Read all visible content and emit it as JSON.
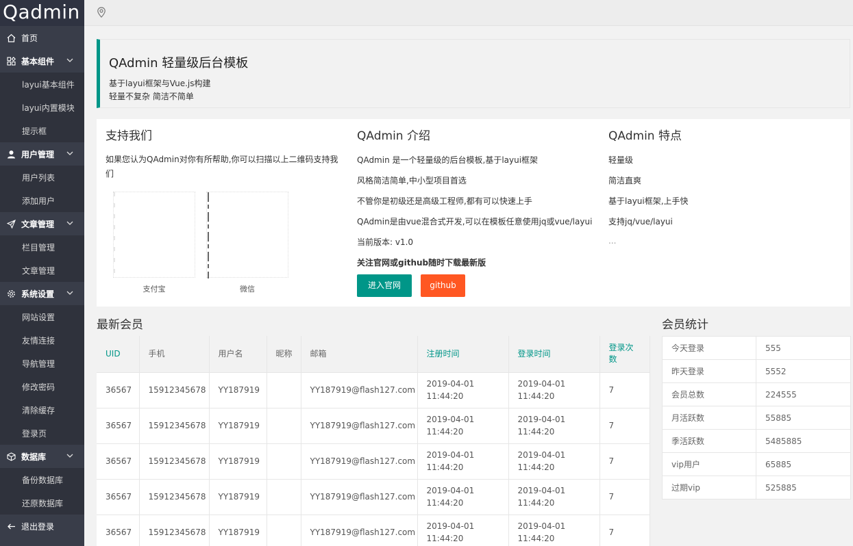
{
  "app": {
    "logo": "Qadmin"
  },
  "sidebar": {
    "items": [
      {
        "label": "首页",
        "type": "top",
        "icon": "home-icon"
      },
      {
        "label": "基本组件",
        "type": "parent",
        "icon": "components-icon"
      },
      {
        "label": "layui基本组件",
        "type": "sub"
      },
      {
        "label": "layui内置模块",
        "type": "sub"
      },
      {
        "label": "提示框",
        "type": "sub"
      },
      {
        "label": "用户管理",
        "type": "parent",
        "icon": "user-icon"
      },
      {
        "label": "用户列表",
        "type": "sub"
      },
      {
        "label": "添加用户",
        "type": "sub"
      },
      {
        "label": "文章管理",
        "type": "parent",
        "icon": "send-icon"
      },
      {
        "label": "栏目管理",
        "type": "sub"
      },
      {
        "label": "文章管理",
        "type": "sub"
      },
      {
        "label": "系统设置",
        "type": "parent",
        "icon": "gear-icon"
      },
      {
        "label": "网站设置",
        "type": "sub"
      },
      {
        "label": "友情连接",
        "type": "sub"
      },
      {
        "label": "导航管理",
        "type": "sub"
      },
      {
        "label": "修改密码",
        "type": "sub"
      },
      {
        "label": "清除缓存",
        "type": "sub"
      },
      {
        "label": "登录页",
        "type": "sub"
      },
      {
        "label": "数据库",
        "type": "parent",
        "icon": "database-icon"
      },
      {
        "label": "备份数据库",
        "type": "sub"
      },
      {
        "label": "还原数据库",
        "type": "sub"
      },
      {
        "label": "退出登录",
        "type": "top",
        "icon": "logout-icon"
      }
    ]
  },
  "topbar": {
    "icon": "location-icon"
  },
  "banner": {
    "title": "QAdmin 轻量级后台模板",
    "line1": "基于layui框架与Vue.js构建",
    "line2": "轻量不复杂 简洁不简单"
  },
  "support": {
    "title": "支持我们",
    "text": "如果您认为QAdmin对你有所帮助,你可以扫描以上二维码支持我们",
    "alipay": "支付宝",
    "wechat": "微信"
  },
  "intro": {
    "title": "QAdmin 介绍",
    "lines": [
      "QAdmin 是一个轻量级的后台模板,基于layui框架",
      "风格简洁简单,中小型项目首选",
      "不管你是初级还是高级工程师,都有可以快速上手",
      "QAdmin是由vue混合式开发,可以在模板任意使用jq或vue/layui",
      "当前版本: v1.0",
      "关注官网或github随时下载最新版"
    ],
    "btn_site": "进入官网",
    "btn_github": "github",
    "colors": {
      "green": "#009688",
      "orange": "#ff5722"
    }
  },
  "features": {
    "title": "QAdmin 特点",
    "lines": [
      "轻量级",
      "简洁直爽",
      "基于layui框架,上手快",
      "支持jq/vue/layui",
      "..."
    ]
  },
  "members": {
    "title": "最新会员",
    "headers": [
      "UID",
      "手机",
      "用户名",
      "昵称",
      "邮箱",
      "注册时间",
      "登录时间",
      "登录次数"
    ],
    "rows": [
      [
        "36567",
        "15912345678",
        "YY187919",
        "",
        "YY187919@flash127.com",
        "2019-04-01 11:44:20",
        "2019-04-01 11:44:20",
        "7"
      ],
      [
        "36567",
        "15912345678",
        "YY187919",
        "",
        "YY187919@flash127.com",
        "2019-04-01 11:44:20",
        "2019-04-01 11:44:20",
        "7"
      ],
      [
        "36567",
        "15912345678",
        "YY187919",
        "",
        "YY187919@flash127.com",
        "2019-04-01 11:44:20",
        "2019-04-01 11:44:20",
        "7"
      ],
      [
        "36567",
        "15912345678",
        "YY187919",
        "",
        "YY187919@flash127.com",
        "2019-04-01 11:44:20",
        "2019-04-01 11:44:20",
        "7"
      ],
      [
        "36567",
        "15912345678",
        "YY187919",
        "",
        "YY187919@flash127.com",
        "2019-04-01 11:44:20",
        "2019-04-01 11:44:20",
        "7"
      ]
    ]
  },
  "stats": {
    "title": "会员统计",
    "rows": [
      [
        "今天登录",
        "555"
      ],
      [
        "昨天登录",
        "5552"
      ],
      [
        "会员总数",
        "224555"
      ],
      [
        "月活跃数",
        "55885"
      ],
      [
        "季活跃数",
        "5485885"
      ],
      [
        "vip用户",
        "65885"
      ],
      [
        "过期vip",
        "525885"
      ]
    ]
  }
}
